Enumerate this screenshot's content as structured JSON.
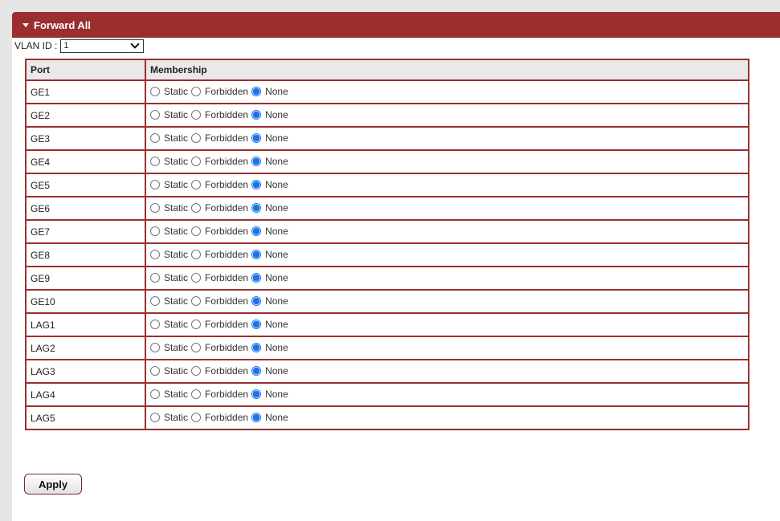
{
  "panel": {
    "title": "Forward All"
  },
  "vlan": {
    "label": "VLAN ID :",
    "selected": "1"
  },
  "table": {
    "headers": {
      "port": "Port",
      "membership": "Membership"
    },
    "options": [
      "Static",
      "Forbidden",
      "None"
    ],
    "rows": [
      {
        "port": "GE1",
        "selected": "None"
      },
      {
        "port": "GE2",
        "selected": "None"
      },
      {
        "port": "GE3",
        "selected": "None"
      },
      {
        "port": "GE4",
        "selected": "None"
      },
      {
        "port": "GE5",
        "selected": "None"
      },
      {
        "port": "GE6",
        "selected": "None"
      },
      {
        "port": "GE7",
        "selected": "None"
      },
      {
        "port": "GE8",
        "selected": "None"
      },
      {
        "port": "GE9",
        "selected": "None"
      },
      {
        "port": "GE10",
        "selected": "None"
      },
      {
        "port": "LAG1",
        "selected": "None"
      },
      {
        "port": "LAG2",
        "selected": "None"
      },
      {
        "port": "LAG3",
        "selected": "None"
      },
      {
        "port": "LAG4",
        "selected": "None"
      },
      {
        "port": "LAG5",
        "selected": "None"
      }
    ]
  },
  "apply": {
    "label": "Apply"
  },
  "colors": {
    "accent": "#9b2f2f",
    "radio_selected": "#1a73e8"
  }
}
